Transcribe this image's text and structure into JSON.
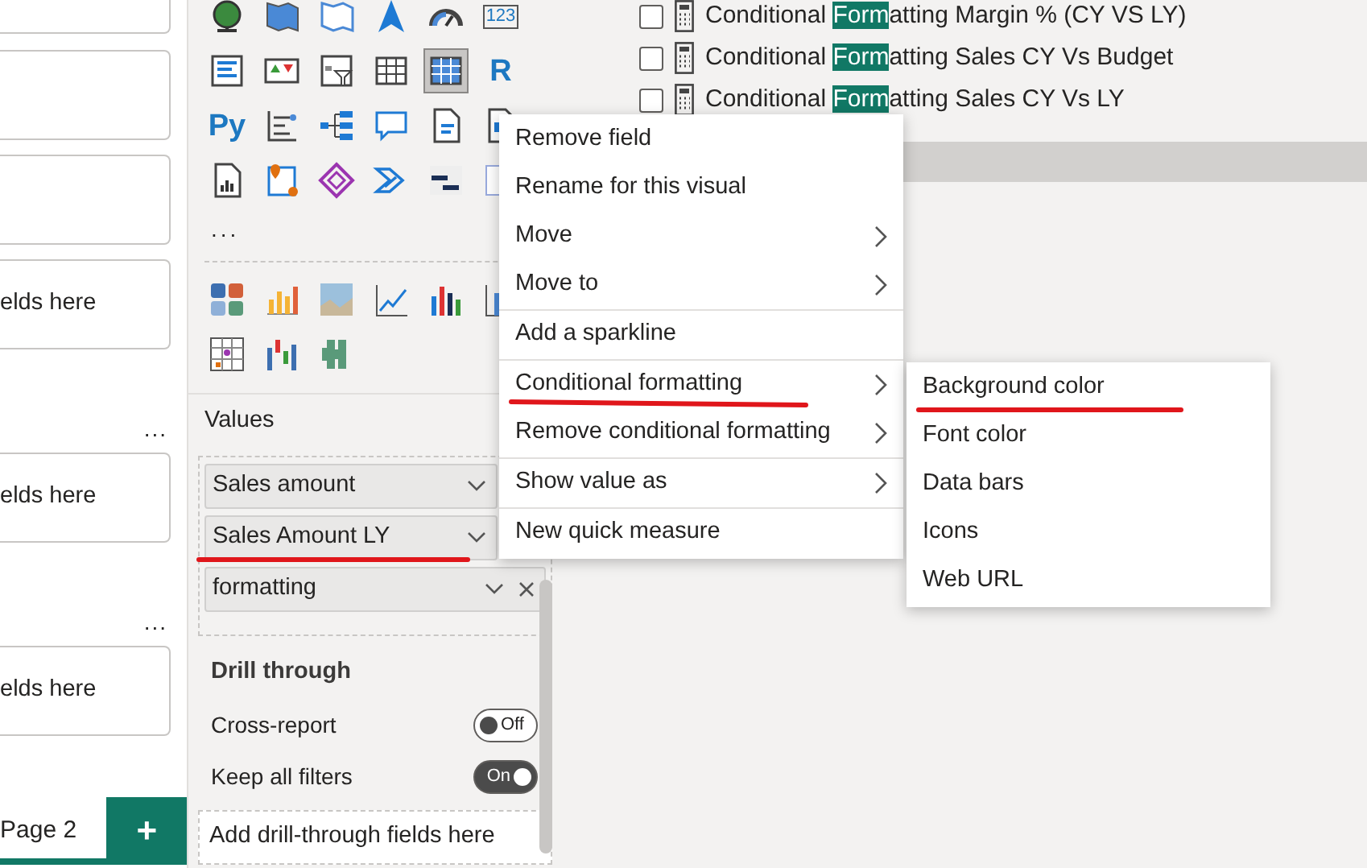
{
  "filter_wells": [
    {
      "kind": "well"
    },
    {
      "kind": "well"
    },
    {
      "kind": "well"
    },
    {
      "kind": "well",
      "text": "elds here"
    },
    {
      "kind": "more",
      "text": "..."
    },
    {
      "kind": "well",
      "text": "elds here"
    },
    {
      "kind": "more",
      "text": "..."
    },
    {
      "kind": "well",
      "text": "elds here"
    }
  ],
  "page_tabs": [
    {
      "kind": "tab",
      "label": "Page 2",
      "selected": true
    },
    {
      "kind": "add",
      "label": "+",
      "selected": false
    }
  ],
  "visuals": [
    {
      "selected": false
    },
    {
      "selected": false
    },
    {
      "selected": false
    },
    {
      "selected": false
    },
    {
      "selected": false
    },
    {
      "selected": false,
      "label": "123"
    },
    {
      "selected": false
    },
    {
      "selected": false
    },
    {
      "selected": false
    },
    {
      "selected": false
    },
    {
      "selected": true
    },
    {
      "selected": false,
      "label": "R"
    },
    {
      "selected": false,
      "label": "Py"
    },
    {
      "selected": false
    },
    {
      "selected": false
    },
    {
      "selected": false
    },
    {
      "selected": false
    },
    {
      "selected": false
    },
    {
      "selected": false
    },
    {
      "selected": false
    },
    {
      "selected": false
    },
    {
      "selected": false
    },
    {
      "selected": false
    },
    {
      "selected": false
    }
  ],
  "more_visuals": "...",
  "custom_visuals": [
    {
      "selected": false
    },
    {
      "selected": false
    },
    {
      "selected": false
    },
    {
      "selected": false
    },
    {
      "selected": false
    },
    {
      "selected": false
    },
    {
      "selected": false
    },
    {
      "selected": false
    },
    {
      "selected": false
    }
  ],
  "values": {
    "title": "Values",
    "fields": [
      {
        "label": "Sales amount",
        "removable": false,
        "underlined": false
      },
      {
        "label": "Sales Amount LY",
        "removable": false,
        "underlined": true
      },
      {
        "label": "formatting",
        "removable": true,
        "underlined": false
      }
    ]
  },
  "drill_through": {
    "title": "Drill through",
    "toggles": [
      {
        "label": "Cross-report",
        "on": false,
        "state": "Off"
      },
      {
        "label": "Keep all filters",
        "on": true,
        "state": "On"
      }
    ],
    "drop_hint": "Add drill-through fields here"
  },
  "field_list": [
    {
      "before": "Conditional ",
      "match": "Form",
      "after": "atting Margin % (CY VS LY)",
      "checked": false
    },
    {
      "before": "Conditional ",
      "match": "Form",
      "after": "atting Sales CY Vs Budget",
      "checked": false
    },
    {
      "before": "Conditional ",
      "match": "Form",
      "after": "atting Sales CY Vs LY",
      "checked": false
    }
  ],
  "context_menu": {
    "groups": [
      [
        {
          "label": "Remove field",
          "submenu": false,
          "underlined": false
        },
        {
          "label": "Rename for this visual",
          "submenu": false,
          "underlined": false
        },
        {
          "label": "Move",
          "submenu": true,
          "underlined": false
        },
        {
          "label": "Move to",
          "submenu": true,
          "underlined": false
        }
      ],
      [
        {
          "label": "Add a sparkline",
          "submenu": false,
          "underlined": false
        }
      ],
      [
        {
          "label": "Conditional formatting",
          "submenu": true,
          "underlined": true
        },
        {
          "label": "Remove conditional formatting",
          "submenu": true,
          "underlined": false
        }
      ],
      [
        {
          "label": "Show value as",
          "submenu": true,
          "underlined": false
        }
      ],
      [
        {
          "label": "New quick measure",
          "submenu": false,
          "underlined": false
        }
      ]
    ]
  },
  "submenu": {
    "items": [
      {
        "label": "Background color",
        "underlined": true
      },
      {
        "label": "Font color",
        "underlined": false
      },
      {
        "label": "Data bars",
        "underlined": false
      },
      {
        "label": "Icons",
        "underlined": false
      },
      {
        "label": "Web URL",
        "underlined": false
      }
    ]
  }
}
